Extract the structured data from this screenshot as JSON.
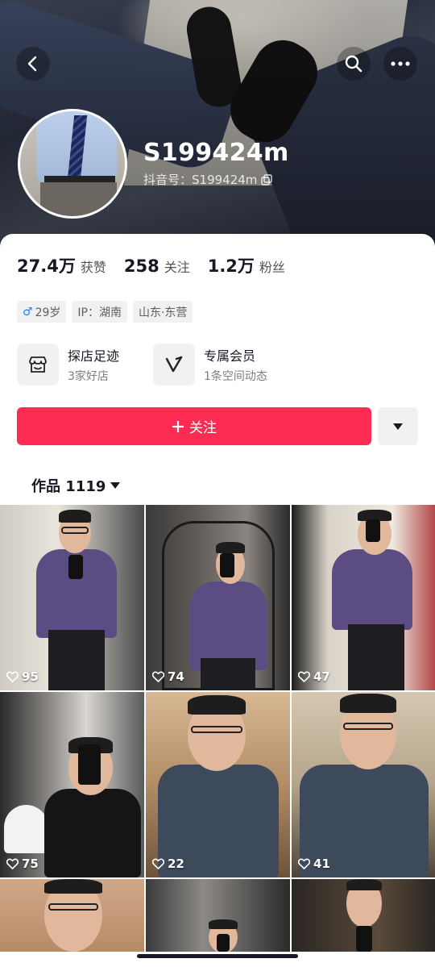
{
  "header": {
    "username": "S199424m",
    "douyin_id_label": "抖音号：S199424m",
    "icons": [
      "back-icon",
      "search-icon",
      "more-icon",
      "copy-icon"
    ]
  },
  "stats": [
    {
      "num": "27.4万",
      "label": "获赞"
    },
    {
      "num": "258",
      "label": "关注"
    },
    {
      "num": "1.2万",
      "label": "粉丝"
    }
  ],
  "tags": {
    "gender_symbol": "♂",
    "age": "29岁",
    "ip": "IP：湖南",
    "location": "山东·东营"
  },
  "features": [
    {
      "title": "探店足迹",
      "sub": "3家好店",
      "icon": "store-icon"
    },
    {
      "title": "专属会员",
      "sub": "1条空间动态",
      "icon": "vip-v-icon"
    }
  ],
  "actions": {
    "follow_label": "关注",
    "follow_icon": "plus-icon",
    "dropdown_icon": "caret-down-icon"
  },
  "works_tab": {
    "label": "作品 1119"
  },
  "videos": [
    {
      "likes": "95"
    },
    {
      "likes": "74"
    },
    {
      "likes": "47"
    },
    {
      "likes": "75"
    },
    {
      "likes": "22"
    },
    {
      "likes": "41"
    },
    {
      "likes": ""
    },
    {
      "likes": ""
    },
    {
      "likes": ""
    }
  ],
  "colors": {
    "accent": "#fe2c55",
    "male": "#2b7de9",
    "tag_bg": "#f1f1f2"
  }
}
